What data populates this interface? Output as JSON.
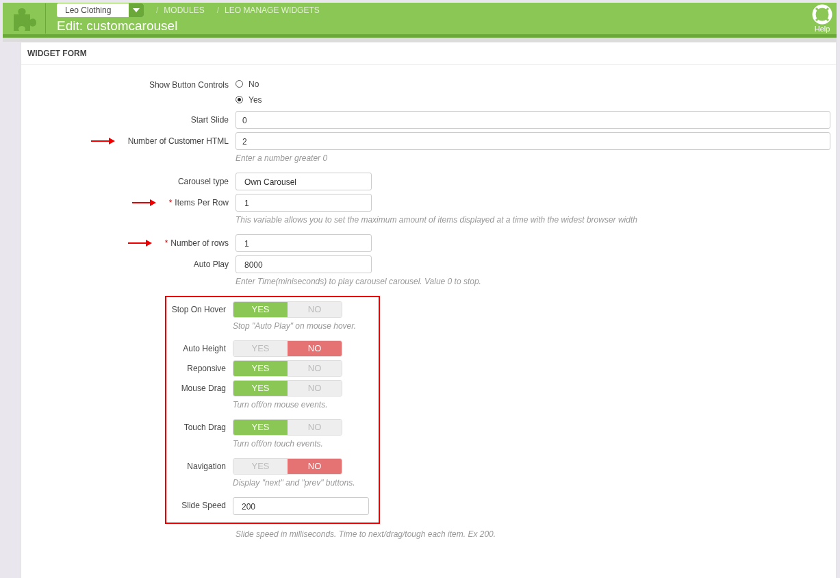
{
  "header": {
    "shop_selector": {
      "value": "Leo Clothing"
    },
    "breadcrumb": [
      {
        "separator": "/",
        "label": "MODULES"
      },
      {
        "separator": "/",
        "label": "LEO MANAGE WIDGETS"
      }
    ],
    "title": "Edit: customcarousel",
    "help": "Help"
  },
  "panel": {
    "title": "WIDGET FORM",
    "fields": [
      {
        "kind": "radio",
        "label": "Show Button Controls",
        "options": [
          {
            "label": "No",
            "selected": false
          },
          {
            "label": "Yes",
            "selected": true
          }
        ]
      },
      {
        "kind": "wide_text",
        "label": "Start Slide",
        "value": "0",
        "arrow": false
      },
      {
        "kind": "wide_text",
        "label": "Number of Customer HTML",
        "value": "2",
        "arrow": true,
        "help": "Enter a number greater 0"
      },
      {
        "kind": "text",
        "label": "Carousel type",
        "value": "Own Carousel",
        "arrow": false
      },
      {
        "kind": "text",
        "label": "Items Per Row",
        "required_mark": "*",
        "value": "1",
        "arrow": true,
        "help": "This variable allows you to set the maximum amount of items displayed at a time with the widest browser width"
      },
      {
        "kind": "text",
        "label": "Number of rows",
        "required_mark": "*",
        "value": "1",
        "arrow": true
      },
      {
        "kind": "text",
        "label": "Auto Play",
        "value": "8000",
        "arrow": false,
        "help": "Enter Time(miniseconds) to play carousel carousel. Value 0 to stop."
      }
    ],
    "highlighted_fields": [
      {
        "kind": "switch",
        "label": "Stop On Hover",
        "on": true,
        "yes": "YES",
        "no": "NO",
        "help": "Stop \"Auto Play\" on mouse hover."
      },
      {
        "kind": "switch",
        "label": "Auto Height",
        "on": false,
        "yes": "YES",
        "no": "NO"
      },
      {
        "kind": "switch",
        "label": "Reponsive",
        "on": true,
        "yes": "YES",
        "no": "NO"
      },
      {
        "kind": "switch",
        "label": "Mouse Drag",
        "on": true,
        "yes": "YES",
        "no": "NO",
        "help": "Turn off/on mouse events."
      },
      {
        "kind": "switch",
        "label": "Touch Drag",
        "on": true,
        "yes": "YES",
        "no": "NO",
        "help": "Turn off/on touch events."
      },
      {
        "kind": "switch",
        "label": "Navigation",
        "on": false,
        "yes": "YES",
        "no": "NO",
        "help": "Display \"next\" and \"prev\" buttons."
      },
      {
        "kind": "text",
        "label": "Slide Speed",
        "value": "200"
      }
    ],
    "after_help": "Slide speed in milliseconds. Time to next/drag/tough each item. Ex 200."
  }
}
